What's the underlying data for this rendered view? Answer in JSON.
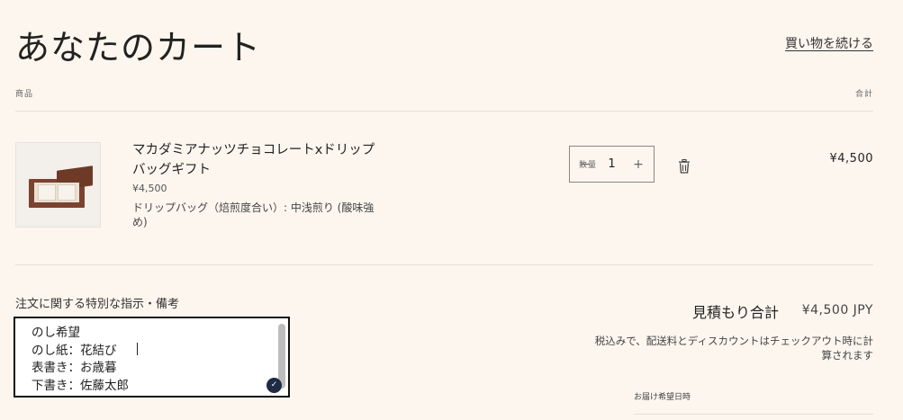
{
  "header": {
    "title": "あなたのカート",
    "continue_link": "買い物を続ける"
  },
  "table_headers": {
    "product": "商品",
    "quantity": "数量",
    "total": "合計"
  },
  "items": [
    {
      "name": "マカダミアナッツチョコレートxドリップバッグギフト",
      "price": "¥4,500",
      "variant": "ドリップバッグ（焙煎度合い）: 中浅煎り (酸味強め)",
      "quantity": "1",
      "line_total": "¥4,500",
      "decrease_symbol": "−",
      "increase_symbol": "+",
      "remove_icon": "trash-icon"
    }
  ],
  "order_note": {
    "label": "注文に関する特別な指示・備考",
    "lines": [
      "のし希望",
      "のし紙：花結び",
      "表書き：お歳暮",
      "下書き：佐藤太郎"
    ]
  },
  "summary": {
    "estimate_label": "見積もり合計",
    "estimate_value": "¥4,500 JPY",
    "tax_note": "税込みで、配送料とディスカウントはチェックアウト時に計算されます",
    "delivery_label": "お届け希望日時"
  }
}
